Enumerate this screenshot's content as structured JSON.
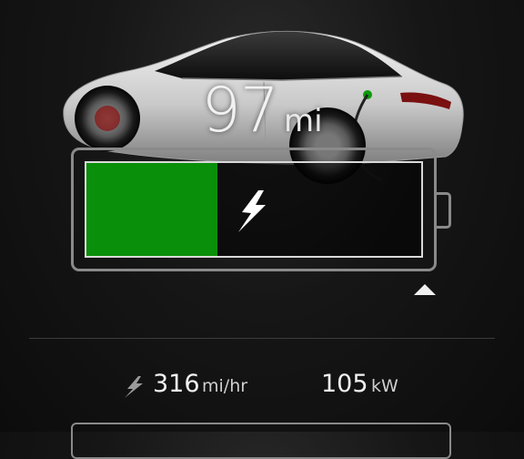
{
  "range": {
    "value": "97",
    "unit": "mi"
  },
  "battery": {
    "charge_fraction": 0.39,
    "charging": true,
    "fill_color": "#0a8f0a"
  },
  "charging_stats": {
    "rate_value": "316",
    "rate_unit": "mi/hr",
    "power_value": "105",
    "power_unit": "kW"
  },
  "icons": [
    "car-image",
    "charging-bolt-icon",
    "charge-limit-marker",
    "charge-rate-icon"
  ],
  "colors": {
    "charge_green": "#0a8f0a",
    "background": "#111111"
  }
}
